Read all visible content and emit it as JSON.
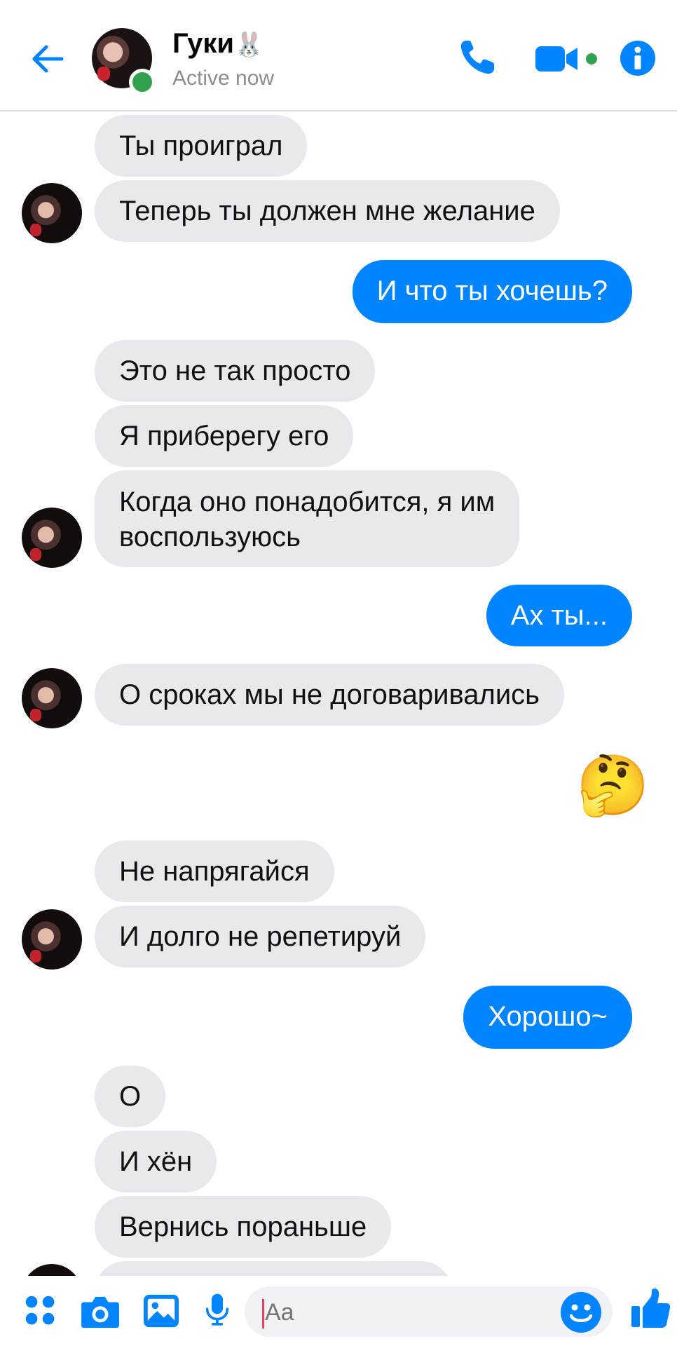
{
  "header": {
    "contact_name": "Гуки",
    "name_emoji": "🐰",
    "status": "Active now"
  },
  "messages": [
    {
      "side": "in",
      "text": "Ты проиграл"
    },
    {
      "side": "in",
      "text": "Теперь ты должен мне желание"
    },
    {
      "side": "out",
      "text": "И что ты хочешь?"
    },
    {
      "side": "in",
      "text": "Это не так просто"
    },
    {
      "side": "in",
      "text": "Я приберегу его"
    },
    {
      "side": "in",
      "text_line1": "Когда оно понадобится, я им",
      "text_line2": "воспользуюсь"
    },
    {
      "side": "out",
      "text": "Ах ты..."
    },
    {
      "side": "in",
      "text": "О сроках мы не договаривались"
    },
    {
      "side": "out",
      "emoji": "🤔"
    },
    {
      "side": "in",
      "text": "Не напрягайся"
    },
    {
      "side": "in",
      "text": "И долго не репетируй"
    },
    {
      "side": "out",
      "text": "Хорошо~"
    },
    {
      "side": "in",
      "text": "О"
    },
    {
      "side": "in",
      "text": "И хён"
    },
    {
      "side": "in",
      "text": "Вернись пораньше"
    }
  ],
  "composer": {
    "placeholder": "Aa"
  },
  "colors": {
    "accent": "#0084ff",
    "incoming_bubble": "#e9e8ec",
    "presence": "#31a24c"
  }
}
